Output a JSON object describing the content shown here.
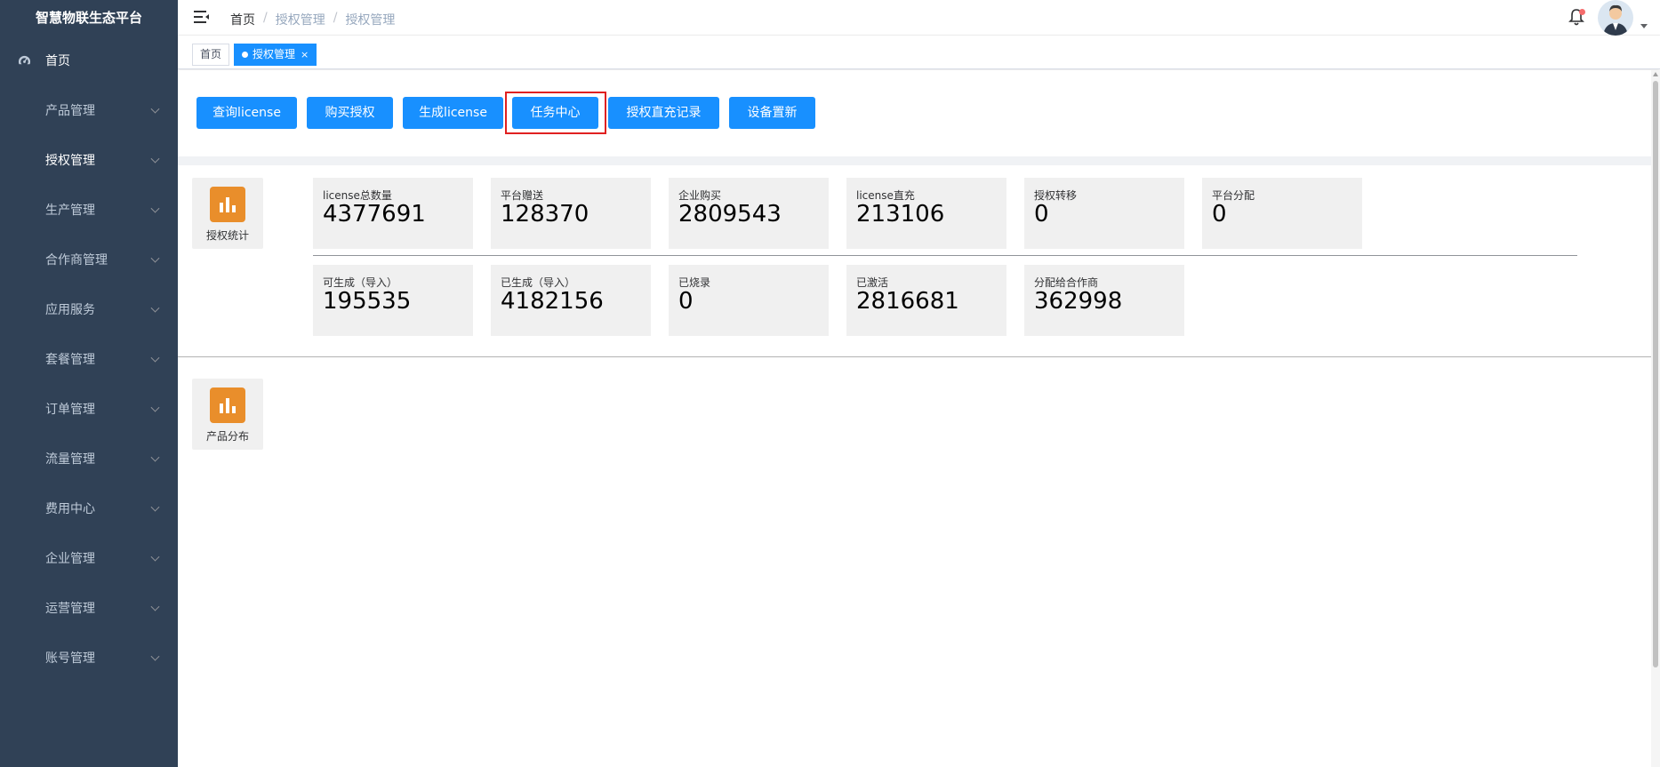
{
  "app": {
    "brand": "智慧物联生态平台"
  },
  "sidebar": {
    "home": "首页",
    "items": [
      {
        "label": "产品管理"
      },
      {
        "label": "授权管理"
      },
      {
        "label": "生产管理"
      },
      {
        "label": "合作商管理"
      },
      {
        "label": "应用服务"
      },
      {
        "label": "套餐管理"
      },
      {
        "label": "订单管理"
      },
      {
        "label": "流量管理"
      },
      {
        "label": "费用中心"
      },
      {
        "label": "企业管理"
      },
      {
        "label": "运营管理"
      },
      {
        "label": "账号管理"
      }
    ]
  },
  "header": {
    "breadcrumb": [
      "首页",
      "授权管理",
      "授权管理"
    ],
    "separator": "/"
  },
  "tags": {
    "home": "首页",
    "active": "授权管理",
    "close": "×"
  },
  "toolbar": {
    "buttons": [
      "查询license",
      "购买授权",
      "生成license",
      "任务中心",
      "授权直充记录",
      "设备置新"
    ],
    "highlighted": "任务中心"
  },
  "stats_section": {
    "title": "授权统计",
    "row1": [
      {
        "label": "license总数量",
        "value": "4377691"
      },
      {
        "label": "平台赠送",
        "value": "128370"
      },
      {
        "label": "企业购买",
        "value": "2809543"
      },
      {
        "label": "license直充",
        "value": "213106"
      },
      {
        "label": "授权转移",
        "value": "0"
      },
      {
        "label": "平台分配",
        "value": "0"
      }
    ],
    "row2": [
      {
        "label": "可生成（导入）",
        "value": "195535"
      },
      {
        "label": "已生成（导入）",
        "value": "4182156"
      },
      {
        "label": "已烧录",
        "value": "0"
      },
      {
        "label": "已激活",
        "value": "2816681"
      },
      {
        "label": "分配给合作商",
        "value": "362998"
      }
    ]
  },
  "product_section": {
    "title": "产品分布"
  },
  "colors": {
    "sidebar_bg": "#304156",
    "primary": "#1890ff",
    "icon_orange": "#e98e2b",
    "highlight_border": "#e02020",
    "notification_dot": "#f56c6c"
  },
  "icons": {
    "home": "dashboard-icon",
    "menu_toggle": "hamburger-icon",
    "notifications": "bell-icon",
    "stats": "bar-chart-icon"
  }
}
